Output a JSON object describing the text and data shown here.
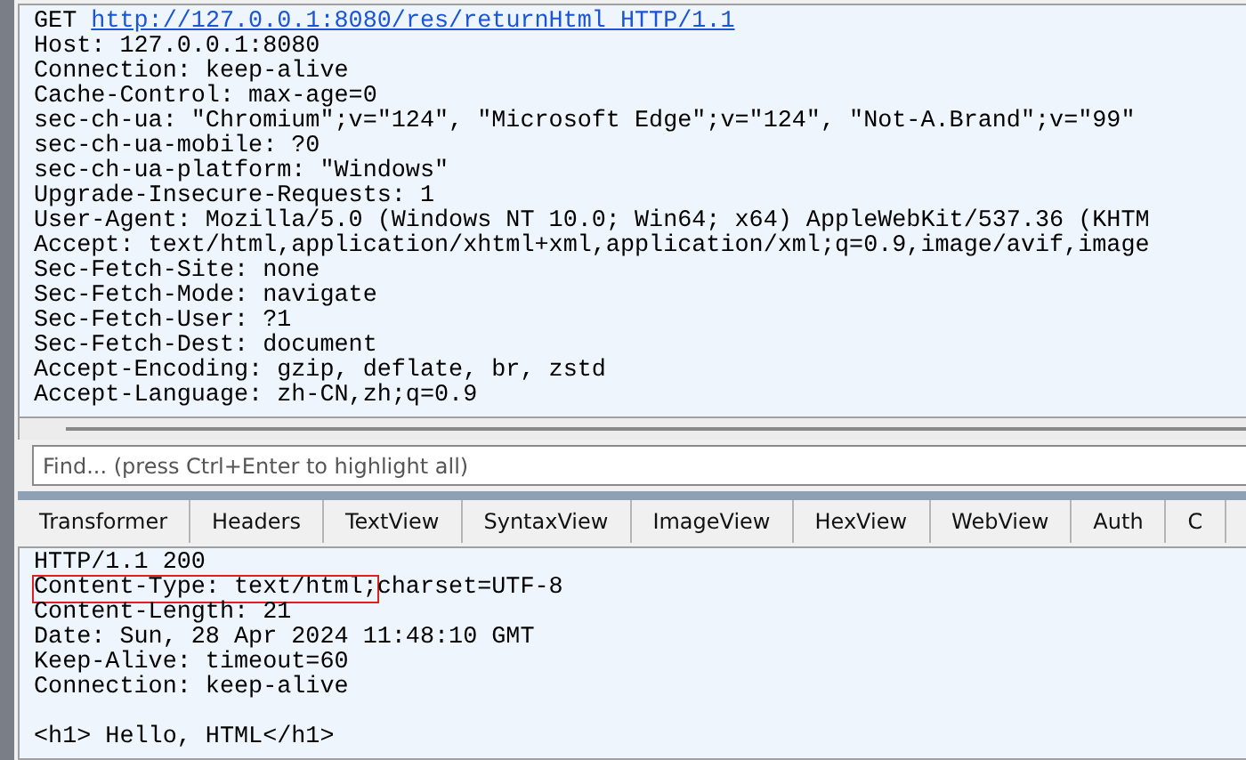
{
  "request": {
    "method": "GET",
    "url": "http://127.0.0.1:8080/res/returnHtml HTTP/1.1",
    "lines": [
      "Host: 127.0.0.1:8080",
      "Connection: keep-alive",
      "Cache-Control: max-age=0",
      "sec-ch-ua: \"Chromium\";v=\"124\", \"Microsoft Edge\";v=\"124\", \"Not-A.Brand\";v=\"99\"",
      "sec-ch-ua-mobile: ?0",
      "sec-ch-ua-platform: \"Windows\"",
      "Upgrade-Insecure-Requests: 1",
      "User-Agent: Mozilla/5.0 (Windows NT 10.0; Win64; x64) AppleWebKit/537.36 (KHTM",
      "Accept: text/html,application/xhtml+xml,application/xml;q=0.9,image/avif,image",
      "Sec-Fetch-Site: none",
      "Sec-Fetch-Mode: navigate",
      "Sec-Fetch-User: ?1",
      "Sec-Fetch-Dest: document",
      "Accept-Encoding: gzip, deflate, br, zstd",
      "Accept-Language: zh-CN,zh;q=0.9"
    ]
  },
  "find": {
    "placeholder": "Find... (press Ctrl+Enter to highlight all)"
  },
  "tabs": [
    {
      "label": "Transformer",
      "selected": false
    },
    {
      "label": "Headers",
      "selected": false
    },
    {
      "label": "TextView",
      "selected": false
    },
    {
      "label": "SyntaxView",
      "selected": false
    },
    {
      "label": "ImageView",
      "selected": false
    },
    {
      "label": "HexView",
      "selected": false
    },
    {
      "label": "WebView",
      "selected": false
    },
    {
      "label": "Auth",
      "selected": false
    },
    {
      "label": "C",
      "selected": false
    }
  ],
  "response": {
    "lines": [
      {
        "text": "HTTP/1.1 200"
      },
      {
        "highlighted": "Content-Type: text/html;",
        "text": "charset=UTF-8"
      },
      {
        "text": "Content-Length: 21"
      },
      {
        "text": "Date: Sun, 28 Apr 2024 11:48:10 GMT"
      },
      {
        "text": "Keep-Alive: timeout=60"
      },
      {
        "text": "Connection: keep-alive"
      }
    ],
    "body": "<h1> Hello, HTML</h1>"
  }
}
